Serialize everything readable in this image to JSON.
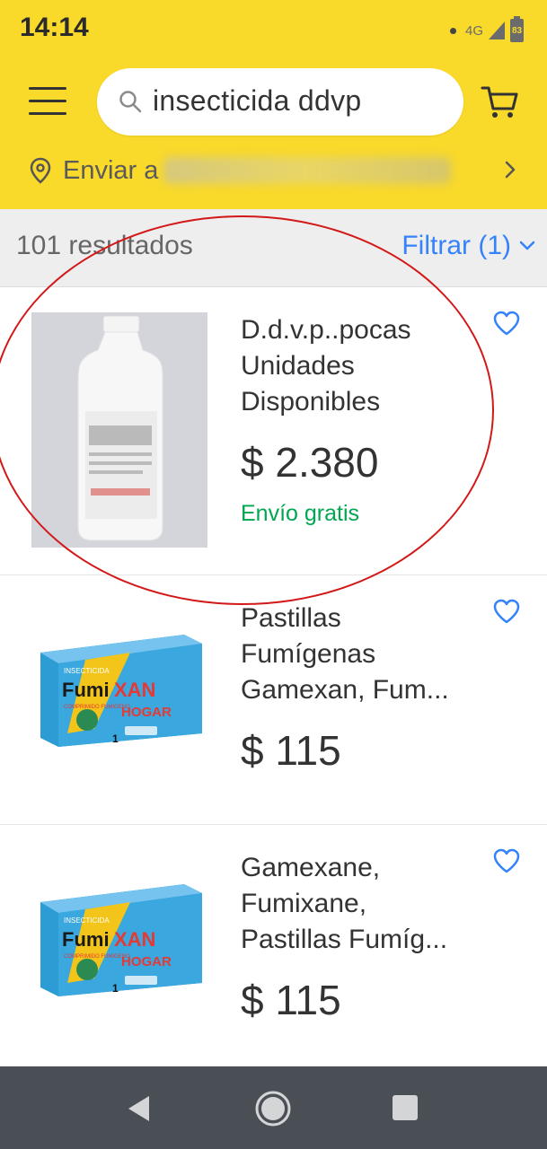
{
  "status_bar": {
    "time": "14:14",
    "network": "4G",
    "battery": "83"
  },
  "header": {
    "search_value": "insecticida ddvp",
    "location_label": "Enviar a"
  },
  "results": {
    "count_label": "101 resultados",
    "filter_label": "Filtrar (1)"
  },
  "items": [
    {
      "title_lines": [
        "D.d.v.p..pocas",
        "Unidades",
        "Disponibles"
      ],
      "price": "$ 2.380",
      "shipping": "Envío gratis",
      "image_icon": "white-bottle-image"
    },
    {
      "title_lines": [
        "Pastillas",
        "Fumígenas",
        "Gamexan, Fum..."
      ],
      "price": "$ 115",
      "image_icon": "fumixan-box-image",
      "box_text": {
        "top": "INSECTICIDA",
        "brand_a": "Fumi",
        "brand_b": "XAN",
        "sub": "HOGAR",
        "tag": "COMPRIMIDO FUMIGENO",
        "qty": "1"
      }
    },
    {
      "title_lines": [
        "Gamexane,",
        "Fumixane,",
        "Pastillas Fumíg..."
      ],
      "price": "$ 115",
      "image_icon": "fumixan-box-image",
      "box_text": {
        "top": "INSECTICIDA",
        "brand_a": "Fumi",
        "brand_b": "XAN",
        "sub": "HOGAR",
        "tag": "COMPRIMIDO FUMIGENO",
        "qty": "1"
      }
    }
  ],
  "colors": {
    "brand_yellow": "#f9d92a",
    "link_blue": "#3483fa",
    "shipping_green": "#00a650",
    "annotation_red": "#d31818"
  }
}
